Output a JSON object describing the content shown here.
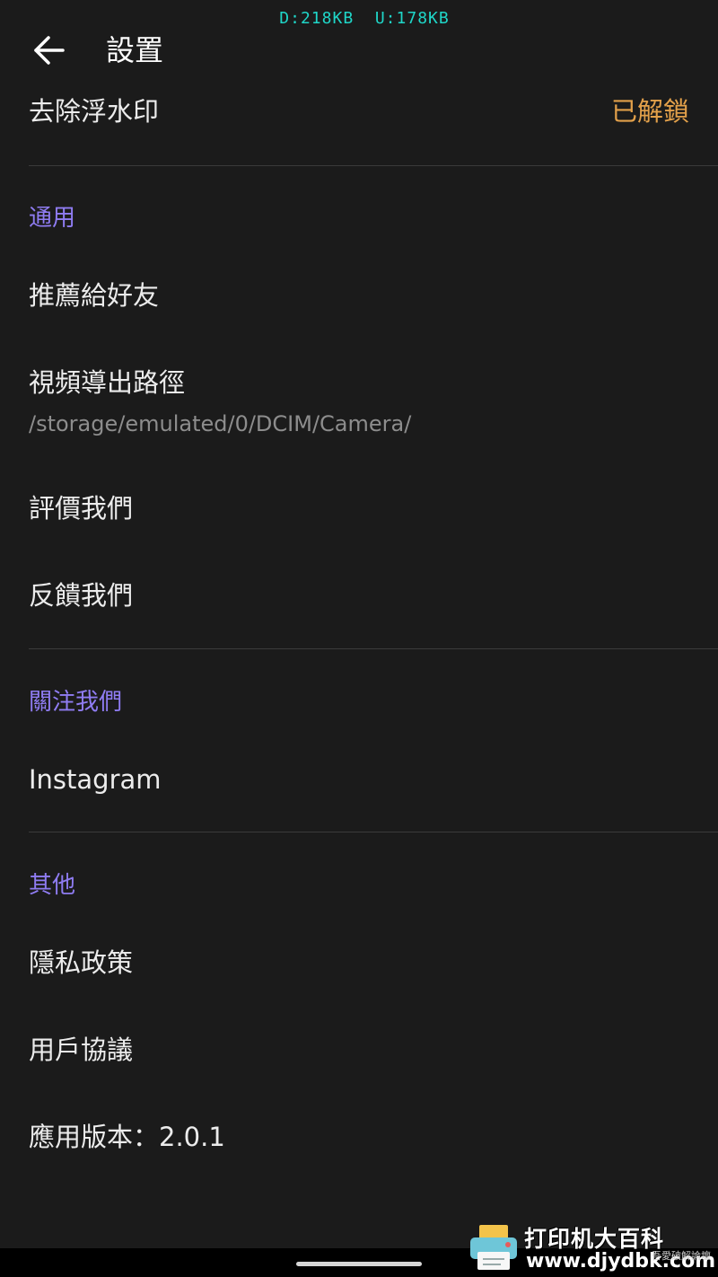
{
  "status_bar": {
    "download": "D:218KB",
    "upload": "U:178KB"
  },
  "app_bar": {
    "title": "設置",
    "back_icon": "arrow-left-icon"
  },
  "watermark_row": {
    "label": "去除浮水印",
    "value": "已解鎖"
  },
  "sections": {
    "general": {
      "header": "通用",
      "items": {
        "recommend": "推薦給好友",
        "export_path_label": "視頻導出路徑",
        "export_path_value": "/storage/emulated/0/DCIM/Camera/",
        "rate": "評價我們",
        "feedback": "反饋我們"
      }
    },
    "follow": {
      "header": "關注我們",
      "items": {
        "instagram": "Instagram"
      }
    },
    "other": {
      "header": "其他",
      "items": {
        "privacy": "隱私政策",
        "agreement": "用戶協議",
        "version": "應用版本：2.0.1"
      }
    }
  },
  "overlay_watermark": {
    "line1": "打印机大百科",
    "line2": "www.djydbk.com",
    "small": "吾愛破解論壇"
  },
  "colors": {
    "background": "#1b1b1b",
    "accent_header": "#8f7cf2",
    "unlocked": "#e2a04a",
    "status_text": "#1fd6c8"
  }
}
